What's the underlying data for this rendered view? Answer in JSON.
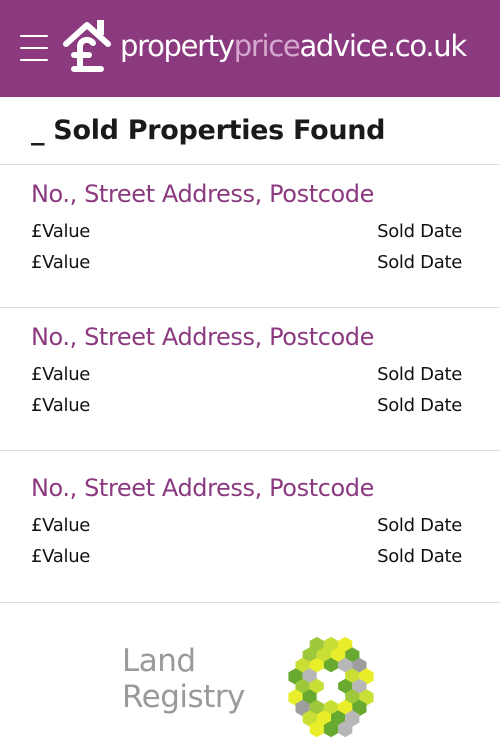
{
  "header": {
    "menu_icon": "hamburger-menu-icon",
    "logo_icon": "house-pound-icon",
    "logo_part1": "property",
    "logo_part2": "price",
    "logo_part3": "advice.co.uk",
    "colors": {
      "brand": "#8c3a80",
      "brand_muted": "#d6a7cf"
    }
  },
  "results_summary": {
    "title": "_ Sold Properties Found"
  },
  "results": [
    {
      "address": "No., Street Address, Postcode",
      "sales": [
        {
          "value": "£Value",
          "date": "Sold Date"
        },
        {
          "value": "£Value",
          "date": "Sold Date"
        }
      ]
    },
    {
      "address": "No., Street Address, Postcode",
      "sales": [
        {
          "value": "£Value",
          "date": "Sold Date"
        },
        {
          "value": "£Value",
          "date": "Sold Date"
        }
      ]
    },
    {
      "address": "No., Street Address, Postcode",
      "sales": [
        {
          "value": "£Value",
          "date": "Sold Date"
        },
        {
          "value": "£Value",
          "date": "Sold Date"
        }
      ]
    }
  ],
  "footer": {
    "land_registry_line1": "Land",
    "land_registry_line2": "Registry",
    "land_registry_icon": "land-registry-hex-logo-icon"
  }
}
